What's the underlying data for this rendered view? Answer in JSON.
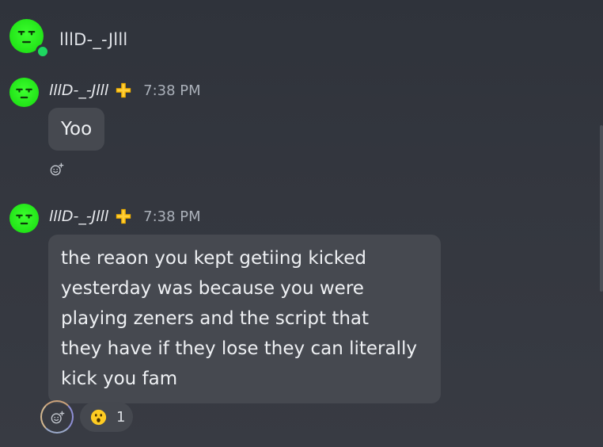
{
  "header": {
    "title": "lllD-_-Jlll",
    "status_color": "#1ed760"
  },
  "messages": [
    {
      "author": "lllD-_-Jlll",
      "badge_icon": "plus-badge-icon",
      "time": "7:38 PM",
      "text": "Yoo"
    },
    {
      "author": "lllD-_-Jlll",
      "badge_icon": "plus-badge-icon",
      "time": "7:38 PM",
      "lines": [
        "the reaon you  kept getiing kicked",
        "yesterday was because you were",
        "playing zeners and the script that",
        "they have if they lose they can literally",
        "kick you fam"
      ],
      "reaction": {
        "emoji": "surprised-face-emoji",
        "count": "1"
      }
    }
  ],
  "colors": {
    "avatar": "#22e418",
    "badge": "#f7b500",
    "bubble": "#464950",
    "background": "#34373f"
  }
}
